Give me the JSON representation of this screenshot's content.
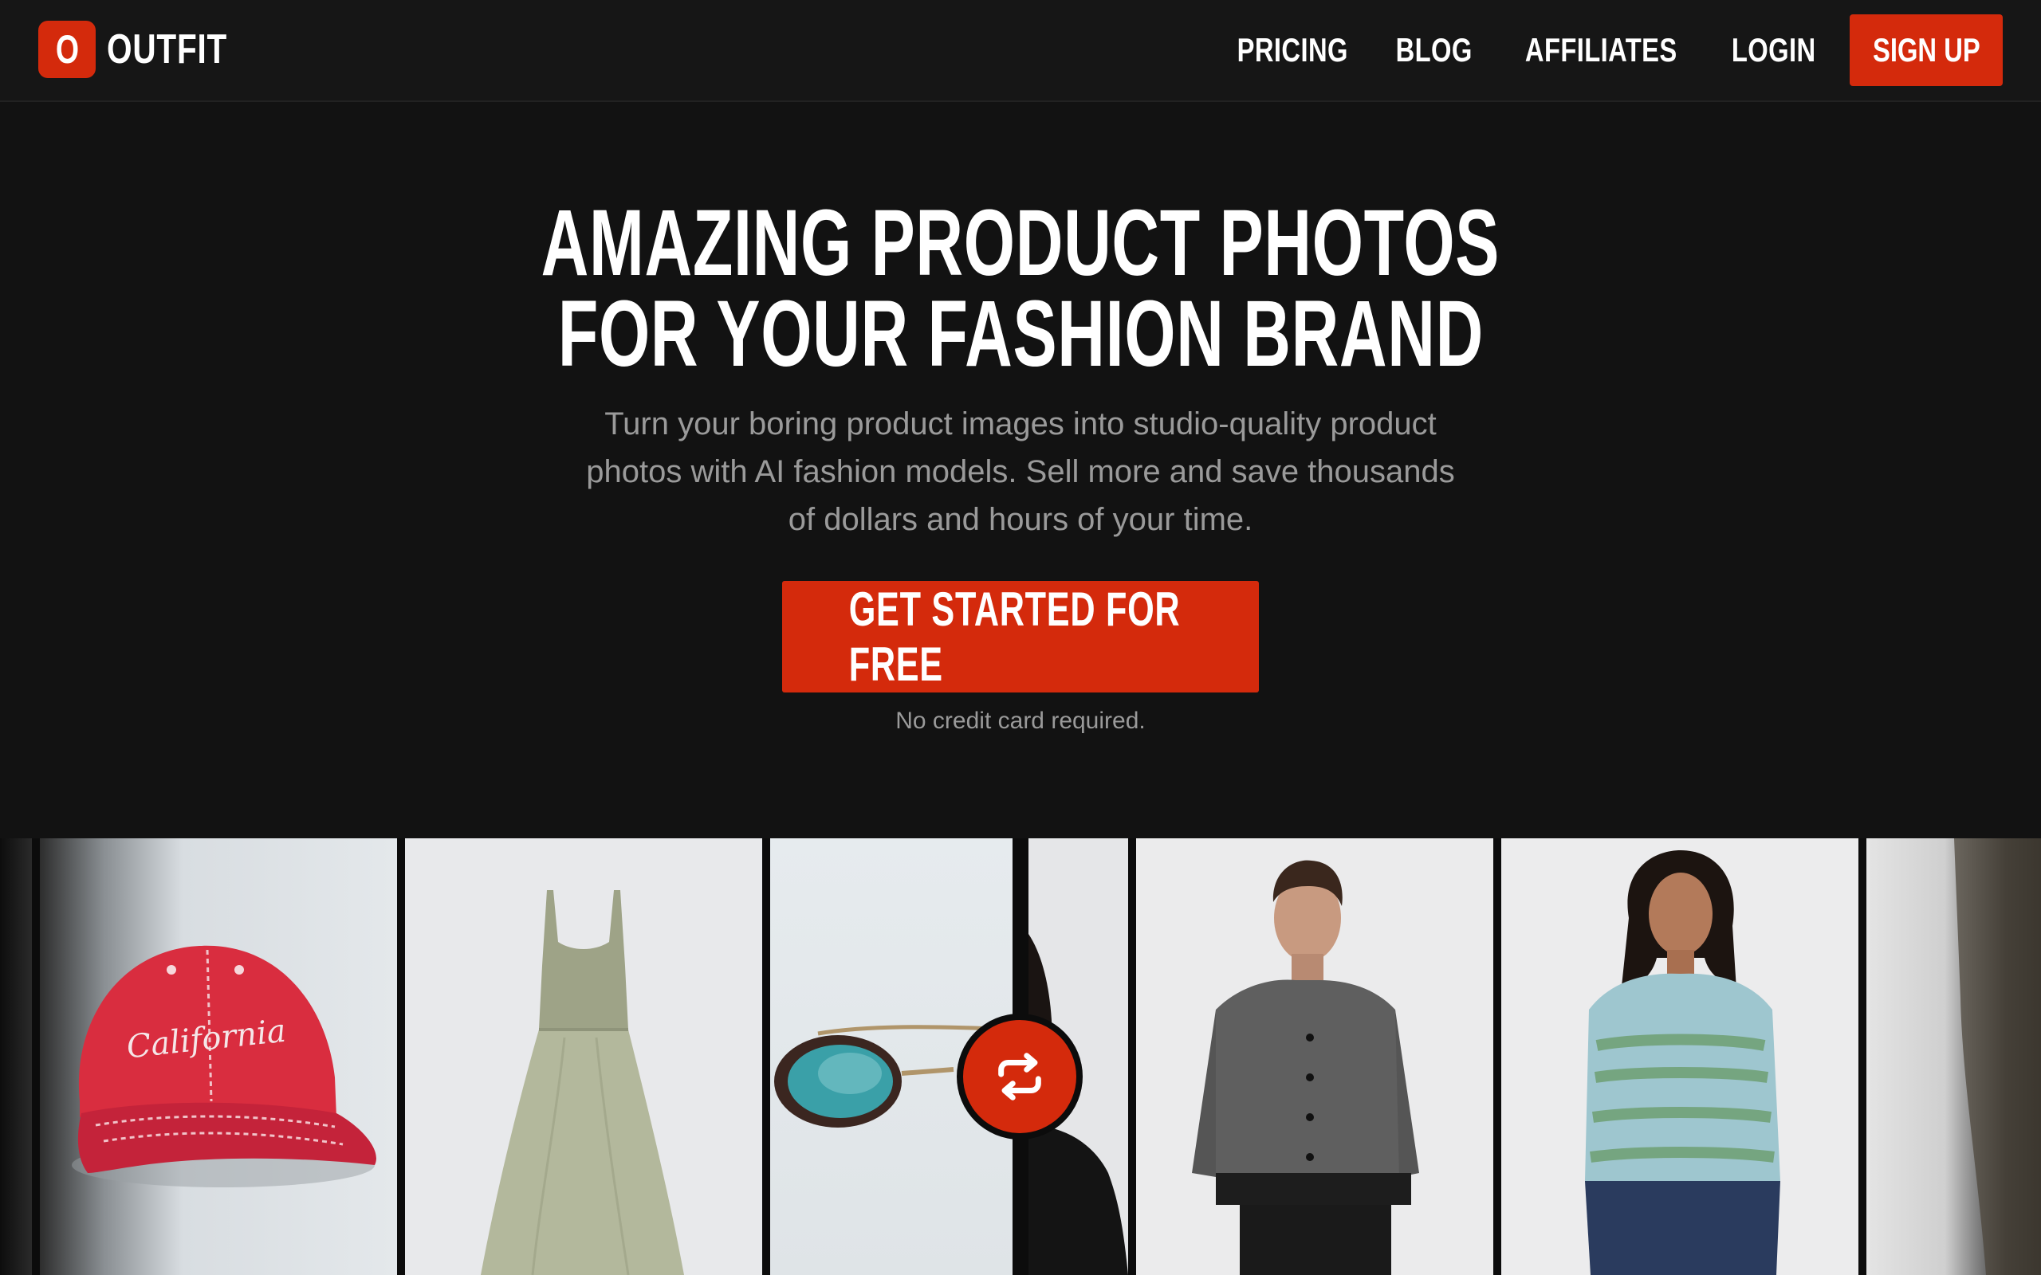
{
  "brand": {
    "logo_letter": "O",
    "name": "OUTFIT",
    "accent_color": "#d42a0c"
  },
  "nav": {
    "links": [
      "PRICING",
      "BLOG",
      "AFFILIATES",
      "LOGIN"
    ],
    "signup_label": "SIGN UP"
  },
  "hero": {
    "title_line1": "AMAZING PRODUCT PHOTOS",
    "title_line2": "FOR YOUR FASHION BRAND",
    "subtitle": "Turn your boring product images into studio-quality product photos with AI fashion models. Sell more and save thousands of dollars and hours of your time.",
    "cta_label": "GET STARTED FOR FREE",
    "note": "No credit card required."
  },
  "gallery": {
    "cap_text": "California",
    "swap_icon": "swap-arrows-icon"
  }
}
